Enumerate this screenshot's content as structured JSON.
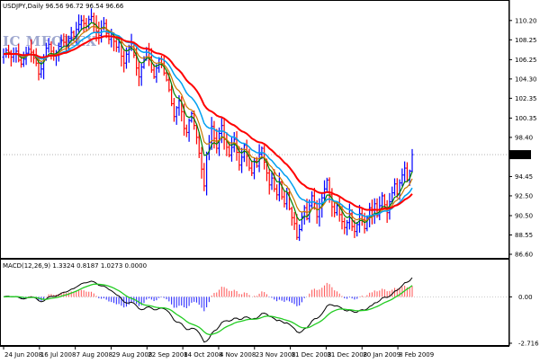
{
  "symbol_info": "USDJPY,Daily",
  "ohlc_label": "96.56 96.72 96.54 96.66",
  "watermark": "IC MFOREX",
  "current_price": "96.66",
  "macd_label": "MACD(12,26,9) 1.3324 0.8187 1.0273 0.0000",
  "colors": {
    "bullish": "#0000ff",
    "bearish": "#ff0000",
    "ma_fast": "#008000",
    "ma_mid": "#c87800",
    "ma_slow": "#00a0f0",
    "ma_slowest": "#ff0000",
    "macd_line": "#000000",
    "signal_line": "#22cc22",
    "hist_pos": "#ff6060",
    "hist_neg": "#3030ff",
    "price_tag_bg": "#000000",
    "price_tag_text": "#ffffff"
  },
  "chart_data": [
    {
      "type": "candlestick",
      "title": "USDJPY,Daily",
      "x_tick_labels": [
        "24 Jun 2008",
        "16 Jul 2008",
        "7 Aug 2008",
        "29 Aug 2008",
        "22 Sep 2008",
        "14 Oct 2008",
        "4 Nov 2008",
        "23 Nov 2008",
        "11 Dec 2008",
        "31 Dec 2008",
        "20 Jan 2009",
        "8 Feb 2009"
      ],
      "y_tick_labels": [
        "110.20",
        "108.25",
        "106.25",
        "104.30",
        "102.35",
        "100.35",
        "98.40",
        "96.66",
        "94.45",
        "92.50",
        "90.50",
        "88.55",
        "86.60"
      ],
      "ylim": [
        86.6,
        111.0
      ],
      "indicators": [
        "MA fast (green)",
        "MA medium (orange)",
        "MA slow (light blue)",
        "MA slowest (red)"
      ],
      "close": [
        106.8,
        107.2,
        107.0,
        106.5,
        106.8,
        107.1,
        106.2,
        105.8,
        106.3,
        106.9,
        107.3,
        107.0,
        106.4,
        105.9,
        104.8,
        105.3,
        106.5,
        107.4,
        107.8,
        107.1,
        106.6,
        107.0,
        107.6,
        108.2,
        108.0,
        107.6,
        108.4,
        109.0,
        108.6,
        109.3,
        109.8,
        110.2,
        109.9,
        109.6,
        110.3,
        110.6,
        109.8,
        109.1,
        108.7,
        109.4,
        109.9,
        108.9,
        108.3,
        108.6,
        108.1,
        107.5,
        108.0,
        106.6,
        105.9,
        106.8,
        107.5,
        107.9,
        106.7,
        105.4,
        104.5,
        105.5,
        106.3,
        107.3,
        106.5,
        105.2,
        104.5,
        105.4,
        106.3,
        105.8,
        104.9,
        104.2,
        103.2,
        101.8,
        100.5,
        101.4,
        102.1,
        101.0,
        99.3,
        98.9,
        100.1,
        100.8,
        99.6,
        98.4,
        96.8,
        95.2,
        93.5,
        96.7,
        97.9,
        99.5,
        98.3,
        97.3,
        98.8,
        99.6,
        98.2,
        97.4,
        96.6,
        97.4,
        98.2,
        96.9,
        95.6,
        96.4,
        97.6,
        96.5,
        95.3,
        94.8,
        96.0,
        95.5,
        96.7,
        97.3,
        95.9,
        94.8,
        93.6,
        94.3,
        93.2,
        92.6,
        93.9,
        92.4,
        91.7,
        92.8,
        91.2,
        90.3,
        89.7,
        88.3,
        89.1,
        90.4,
        91.3,
        90.2,
        91.5,
        92.5,
        91.7,
        90.4,
        91.3,
        92.3,
        93.2,
        94.1,
        92.6,
        91.4,
        90.8,
        91.5,
        90.6,
        89.9,
        89.3,
        89.8,
        90.7,
        89.4,
        88.9,
        89.6,
        90.7,
        90.1,
        89.2,
        90.3,
        91.3,
        90.6,
        91.7,
        90.5,
        91.5,
        92.5,
        91.6,
        90.8,
        91.9,
        92.8,
        93.7,
        92.7,
        93.8,
        94.6,
        95.3,
        94.1,
        95.0,
        96.66
      ]
    },
    {
      "type": "macd",
      "title": "MACD(12,26,9) 1.3324 0.8187 1.0273 0.0000",
      "y_tick_labels": [
        "0.00",
        "-2.716"
      ],
      "ylim": [
        -2.716,
        1.6
      ]
    }
  ]
}
